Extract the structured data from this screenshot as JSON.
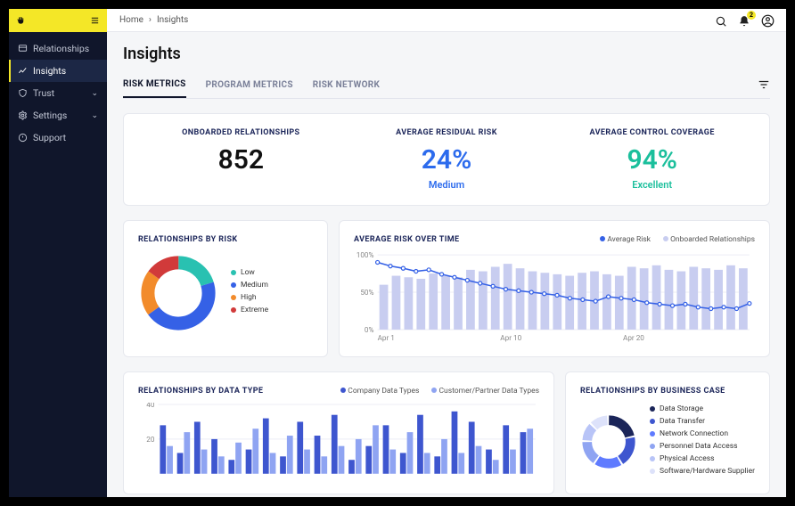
{
  "brand": {
    "notif_count": "2"
  },
  "sidebar": {
    "items": [
      {
        "label": "Relationships"
      },
      {
        "label": "Insights"
      },
      {
        "label": "Trust"
      },
      {
        "label": "Settings"
      },
      {
        "label": "Support"
      }
    ]
  },
  "breadcrumb": {
    "a": "Home",
    "b": "Insights"
  },
  "page": {
    "title": "Insights"
  },
  "tabs": {
    "t0": "RISK METRICS",
    "t1": "PROGRAM METRICS",
    "t2": "RISK NETWORK"
  },
  "kpi": {
    "onboarded": {
      "label": "ONBOARDED RELATIONSHIPS",
      "value": "852"
    },
    "residual": {
      "label": "AVERAGE RESIDUAL RISK",
      "value": "24%",
      "sub": "Medium"
    },
    "coverage": {
      "label": "AVERAGE CONTROL COVERAGE",
      "value": "94%",
      "sub": "Excellent"
    }
  },
  "risk_donut": {
    "title": "RELATIONSHIPS BY RISK",
    "legend": [
      "Low",
      "Medium",
      "High",
      "Extreme"
    ]
  },
  "risk_over_time": {
    "title": "AVERAGE RISK OVER TIME",
    "legend_a": "Average Risk",
    "legend_b": "Onboarded Relationships",
    "y0": "0%",
    "y50": "50%",
    "y100": "100%",
    "x0": "Apr 1",
    "x1": "Apr 10",
    "x2": "Apr 20"
  },
  "data_type": {
    "title": "RELATIONSHIPS BY DATA TYPE",
    "legend_a": "Company Data Types",
    "legend_b": "Customer/Partner Data Types",
    "y40": "40",
    "y20": "20"
  },
  "biz_case": {
    "title": "RELATIONSHIPS BY BUSINESS CASE",
    "legend": [
      "Data Storage",
      "Data Transfer",
      "Network Connection",
      "Personnel Data Access",
      "Physical Access",
      "Software/Hardware Supplier"
    ]
  },
  "colors": {
    "low": "#29c1b1",
    "medium": "#3561e6",
    "high": "#f28b2b",
    "extreme": "#d13a3a",
    "bar_a": "#3e56cf",
    "bar_b": "#8fa4f2",
    "line": "#3561e6",
    "area_bar": "#c8cdf0",
    "biz": [
      "#1b2559",
      "#3e56cf",
      "#5f7bff",
      "#8fa4f2",
      "#b8c4f7",
      "#dde2fa"
    ]
  },
  "chart_data": [
    {
      "type": "pie",
      "title": "RELATIONSHIPS BY RISK",
      "series": [
        {
          "name": "Low",
          "value": 20,
          "color": "#29c1b1"
        },
        {
          "name": "Medium",
          "value": 45,
          "color": "#3561e6"
        },
        {
          "name": "High",
          "value": 20,
          "color": "#f28b2b"
        },
        {
          "name": "Extreme",
          "value": 15,
          "color": "#d13a3a"
        }
      ]
    },
    {
      "type": "line",
      "title": "AVERAGE RISK OVER TIME",
      "xlabel": "",
      "ylabel": "",
      "ylim_left": [
        0,
        100
      ],
      "x_ticks": [
        "Apr 1",
        "Apr 10",
        "Apr 20"
      ],
      "series": [
        {
          "name": "Onboarded Relationships",
          "kind": "bar",
          "values": [
            60,
            72,
            70,
            68,
            75,
            72,
            70,
            80,
            78,
            84,
            88,
            82,
            78,
            76,
            74,
            72,
            76,
            78,
            74,
            72,
            84,
            82,
            86,
            80,
            78,
            84,
            82,
            80,
            86,
            82
          ]
        },
        {
          "name": "Average Risk",
          "kind": "line",
          "unit": "%",
          "values": [
            90,
            85,
            82,
            78,
            80,
            74,
            70,
            66,
            62,
            58,
            54,
            52,
            50,
            48,
            46,
            42,
            40,
            38,
            44,
            42,
            40,
            36,
            34,
            32,
            34,
            30,
            28,
            30,
            28,
            35
          ]
        }
      ]
    },
    {
      "type": "bar",
      "title": "RELATIONSHIPS BY DATA TYPE",
      "ylim": [
        0,
        40
      ],
      "y_ticks": [
        20,
        40
      ],
      "series": [
        {
          "name": "Company Data Types",
          "color": "#3e56cf",
          "values": [
            28,
            12,
            30,
            20,
            8,
            14,
            32,
            10,
            30,
            22,
            34,
            8,
            16,
            28,
            12,
            34,
            10,
            36,
            30,
            14,
            28,
            24
          ]
        },
        {
          "name": "Customer/Partner Data Types",
          "color": "#8fa4f2",
          "values": [
            16,
            24,
            14,
            10,
            18,
            26,
            12,
            22,
            14,
            10,
            16,
            20,
            28,
            14,
            24,
            12,
            20,
            12,
            16,
            8,
            14,
            26
          ]
        }
      ]
    },
    {
      "type": "pie",
      "title": "RELATIONSHIPS BY BUSINESS CASE",
      "series": [
        {
          "name": "Data Storage",
          "value": 22,
          "color": "#1b2559"
        },
        {
          "name": "Data Transfer",
          "value": 20,
          "color": "#3e56cf"
        },
        {
          "name": "Network Connection",
          "value": 18,
          "color": "#5f7bff"
        },
        {
          "name": "Personnel Data Access",
          "value": 16,
          "color": "#8fa4f2"
        },
        {
          "name": "Physical Access",
          "value": 12,
          "color": "#b8c4f7"
        },
        {
          "name": "Software/Hardware Supplier",
          "value": 12,
          "color": "#dde2fa"
        }
      ]
    }
  ]
}
